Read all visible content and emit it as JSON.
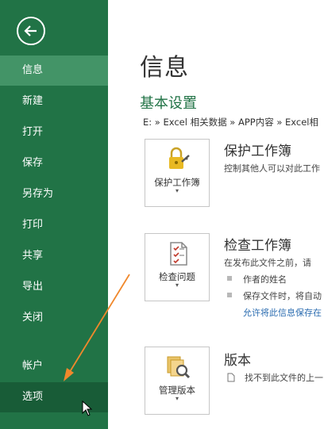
{
  "sidebar": {
    "items": [
      {
        "label": "信息"
      },
      {
        "label": "新建"
      },
      {
        "label": "打开"
      },
      {
        "label": "保存"
      },
      {
        "label": "另存为"
      },
      {
        "label": "打印"
      },
      {
        "label": "共享"
      },
      {
        "label": "导出"
      },
      {
        "label": "关闭"
      },
      {
        "label": "帐户"
      },
      {
        "label": "选项"
      }
    ]
  },
  "main": {
    "title": "信息",
    "section": "基本设置",
    "path": "E: » Excel 相关数据 » APP内容 » Excel相",
    "protect": {
      "button": "保护工作簿",
      "title": "保护工作簿",
      "desc": "控制其他人可以对此工作"
    },
    "inspect": {
      "button": "检查问题",
      "title": "检查工作簿",
      "desc": "在发布此文件之前，请",
      "bullets": [
        "作者的姓名",
        "保存文件时，将自动"
      ],
      "link": "允许将此信息保存在"
    },
    "versions": {
      "button": "管理版本",
      "title": "版本",
      "desc": "找不到此文件的上一"
    }
  },
  "colors": {
    "sidebar": "#217346",
    "active": "#439467",
    "hover": "#185c37",
    "arrow": "#f0882c",
    "link": "#2b6cb0"
  }
}
